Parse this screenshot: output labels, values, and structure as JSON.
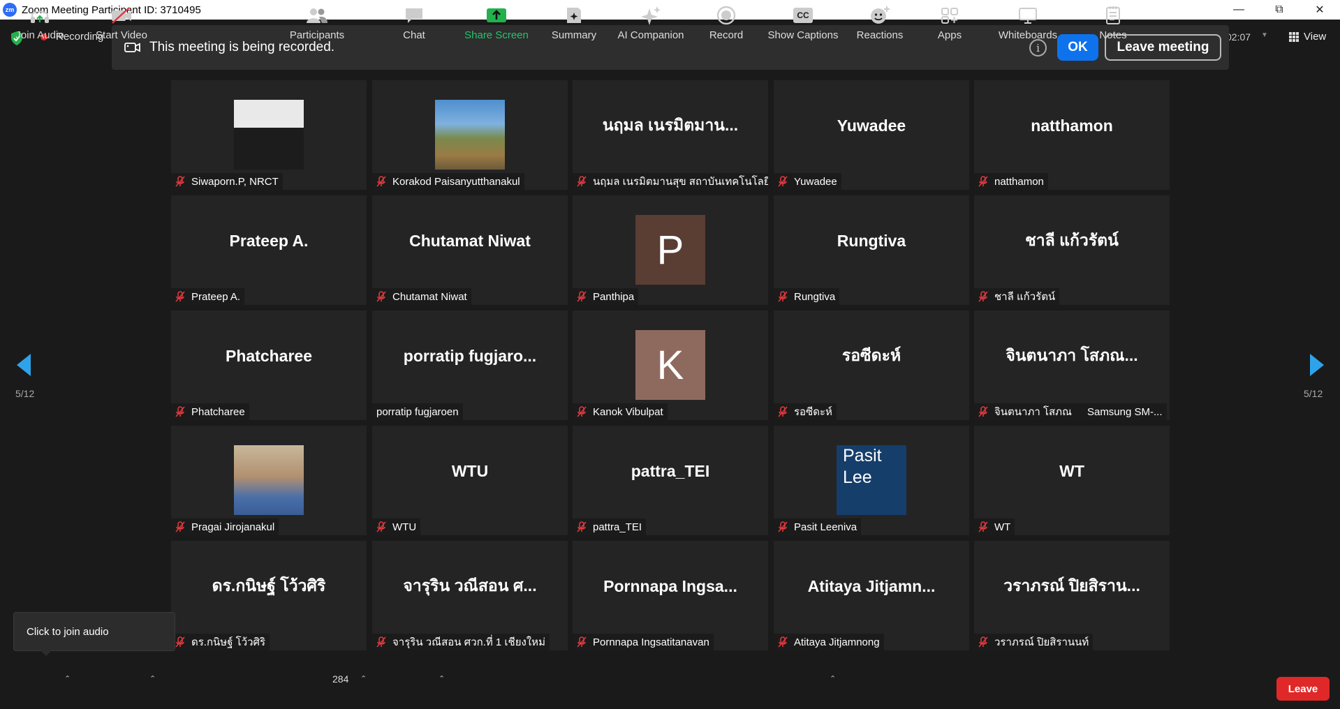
{
  "window": {
    "title": "Zoom Meeting Participant ID: 3710495",
    "logo": "zm"
  },
  "topbar": {
    "recording_label": "Recording",
    "clock": "02:07",
    "view_label": "View"
  },
  "banner": {
    "message": "This meeting is being recorded.",
    "ok_label": "OK",
    "leave_label": "Leave meeting",
    "info_glyph": "i"
  },
  "pagination": {
    "left": "5/12",
    "right": "5/12"
  },
  "tiles": [
    {
      "big": "",
      "label": "Siwaporn.P, NRCT",
      "muted": true
    },
    {
      "big": "",
      "label": "Korakod Paisanyutthanakul",
      "muted": true
    },
    {
      "big": "นฤมล เนรมิตมาน...",
      "label": "นฤมล เนรมิตมานสุข สถาบันเทคโนโลยี...",
      "muted": true
    },
    {
      "big": "Yuwadee",
      "label": "Yuwadee",
      "muted": true
    },
    {
      "big": "natthamon",
      "label": "natthamon",
      "muted": true
    },
    {
      "big": "Prateep A.",
      "label": "Prateep A.",
      "muted": true
    },
    {
      "big": "Chutamat Niwat",
      "label": "Chutamat Niwat",
      "muted": true
    },
    {
      "big": "P",
      "label": "Panthipa",
      "muted": true,
      "avatar_color": "#5a3d33"
    },
    {
      "big": "Rungtiva",
      "label": "Rungtiva",
      "muted": true
    },
    {
      "big": "ชาลี แก้วรัตน์",
      "label": "ชาลี แก้วรัตน์",
      "muted": true
    },
    {
      "big": "Phatcharee",
      "label": "Phatcharee",
      "muted": true
    },
    {
      "big": "porratip fugjaro...",
      "label": "porratip fugjaroen",
      "muted": false
    },
    {
      "big": "K",
      "label": "Kanok Vibulpat",
      "muted": true,
      "avatar_color": "#8e6a5e"
    },
    {
      "big": "รอซีดะห์",
      "label": "รอซีดะห์",
      "muted": true
    },
    {
      "big": "จินตนาภา โสภณ...",
      "label": "จินตนาภา โสภณ",
      "extra": "Samsung SM-...",
      "muted": true
    },
    {
      "big": "",
      "label": "Pragai Jirojanakul",
      "muted": true
    },
    {
      "big": "WTU",
      "label": "WTU",
      "muted": true
    },
    {
      "big": "pattra_TEI",
      "label": "pattra_TEI",
      "muted": true
    },
    {
      "big": "Pasit",
      "big2": "Lee",
      "label": "Pasit Leeniva",
      "muted": true,
      "avatar_color": "#153e6b"
    },
    {
      "big": "WT",
      "label": "WT",
      "muted": true
    },
    {
      "big": "ดร.กนิษฐ์ โว้วศิริ",
      "label": "ดร.กนิษฐ์ โว้วศิริ",
      "muted": true
    },
    {
      "big": "จารุริน วณีสอน ศ...",
      "label": "จารุริน วณีสอน ศวก.ที่ 1 เชียงใหม่",
      "muted": true
    },
    {
      "big": "Pornnapa Ingsa...",
      "label": "Pornnapa Ingsatitanavan",
      "muted": true
    },
    {
      "big": "Atitaya Jitjamn...",
      "label": "Atitaya Jitjamnong",
      "muted": true
    },
    {
      "big": "วราภรณ์ ปิยสิราน...",
      "label": "วราภรณ์ ปิยสิรานนท์",
      "muted": true
    }
  ],
  "tooltip": "Click to join audio",
  "toolbar": {
    "join_audio": "Join Audio",
    "start_video": "Start Video",
    "participants": "Participants",
    "participants_count": "284",
    "chat": "Chat",
    "share_screen": "Share Screen",
    "summary": "Summary",
    "ai_companion": "AI Companion",
    "record": "Record",
    "show_captions": "Show Captions",
    "reactions": "Reactions",
    "apps": "Apps",
    "whiteboards": "Whiteboards",
    "notes": "Notes",
    "leave": "Leave",
    "cc_glyph": "CC"
  },
  "colors": {
    "accent_blue": "#0e72ed",
    "leave_red": "#e02828",
    "share_green": "#25c46b",
    "muted_red": "#e0393e",
    "nav_arrow": "#2fa3ea"
  }
}
